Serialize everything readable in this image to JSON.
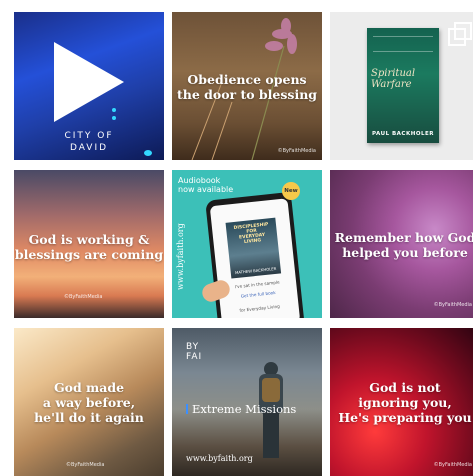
{
  "tiles": [
    {
      "id": "city-of-david",
      "caption": "CITY OF\nDAVID",
      "icon": "play-icon"
    },
    {
      "id": "obedience",
      "quote": "Obedience opens\nthe door to blessing",
      "credit": "©ByFaithMedia"
    },
    {
      "id": "spiritual-warfare",
      "book_title": "Spiritual\nWarfare",
      "book_author": "PAUL BACKHOLER",
      "icon": "multiple-images-icon"
    },
    {
      "id": "god-is-working",
      "quote": "God is working &\nblessings are coming",
      "credit": "©ByFaithMedia"
    },
    {
      "id": "audiobook",
      "label_line1": "Audiobook",
      "label_line2": "now available",
      "badge": "New",
      "site": "www.byfaith.org",
      "cover_title": "DISCIPLESHIP FOR\nEVERYDAY\nLIVING",
      "cover_author": "MATHEW BACKHOLER",
      "sample_text": "I've sat in the sample",
      "link_text": "Get the full book",
      "footer_text": "for Everyday Living"
    },
    {
      "id": "remember",
      "quote": "Remember how God\nhelped you before",
      "credit": "©ByFaithMedia"
    },
    {
      "id": "god-made-a-way",
      "quote": "God made\na way before,\nhe'll do it again",
      "credit": "©ByFaithMedia"
    },
    {
      "id": "extreme-missions",
      "logo": "BY\nFAI",
      "title": "Extreme Missions",
      "site": "www.byfaith.org"
    },
    {
      "id": "not-ignoring",
      "quote": "God is not\nignoring you,\nHe's preparing you",
      "credit": "©ByFaithMedia"
    }
  ],
  "colors": {
    "accent_blue": "#3a8fff",
    "badge_yellow": "#f6c84a",
    "audiobook_teal": "#3cc0b8"
  }
}
